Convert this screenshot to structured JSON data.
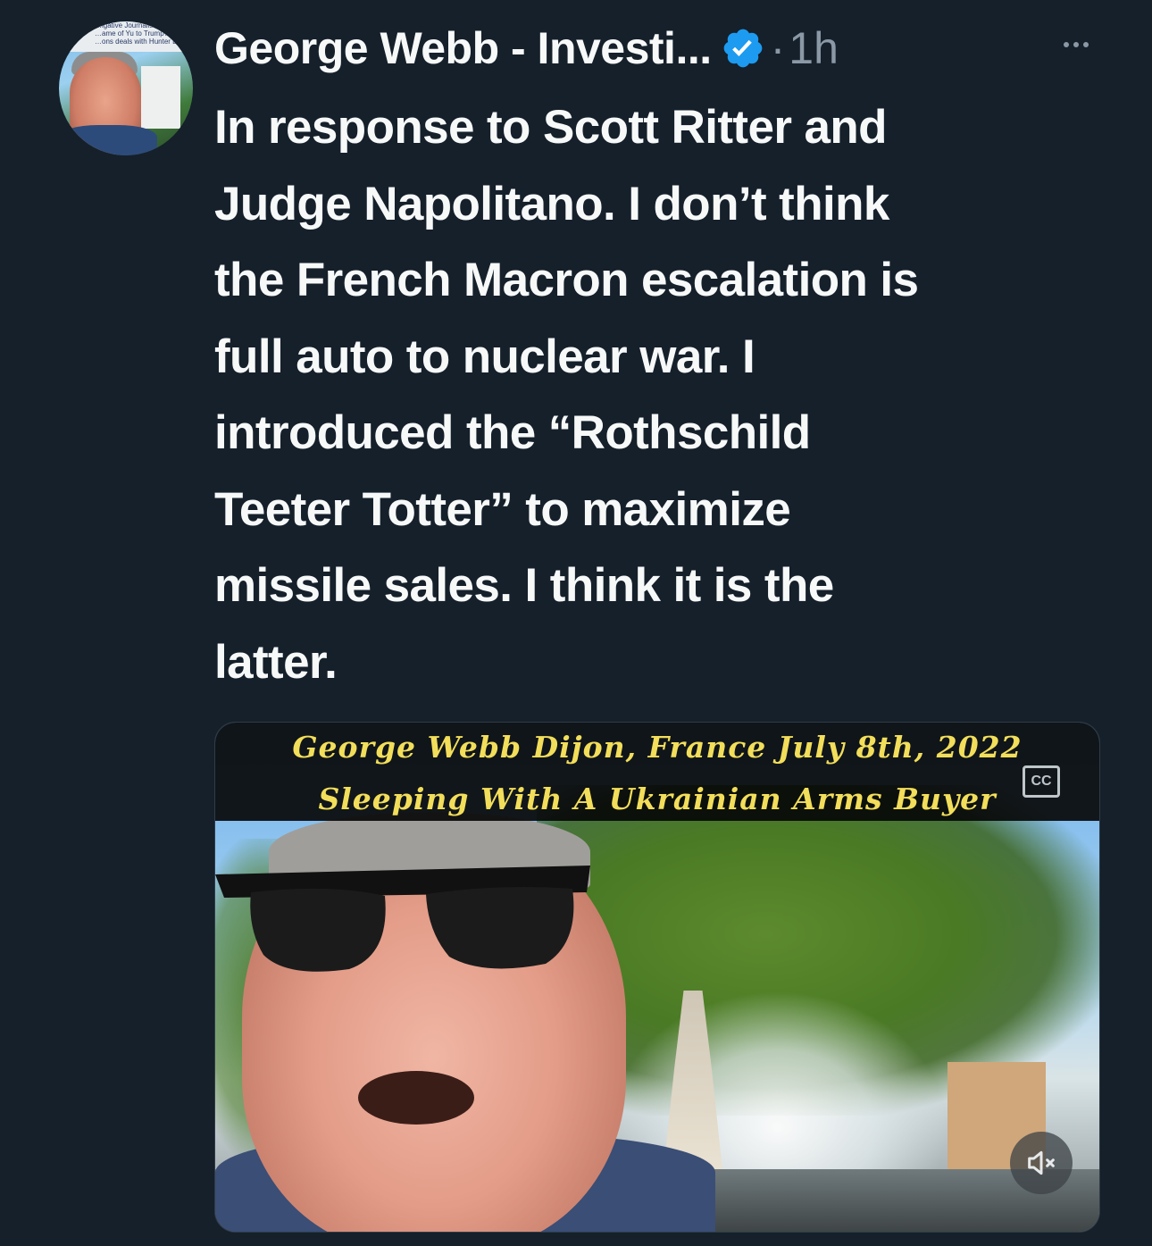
{
  "tweet": {
    "author_name": "George Webb - Investi...",
    "time": "1h",
    "separator": "·",
    "text": "In response to Scott Ritter and\nJudge Napolitano. I don’t think\nthe French Macron escalation is\nfull auto to nuclear war.  I\nintroduced the “Rothschild\nTeeter Totter” to maximize\nmissile sales.  I think it is the\nlatter.",
    "avatar_caption_lines": [
      "…igative Journalist",
      "…ame of Yu to Trump? Didn't he",
      "…ons deals with Hunter Biden with his"
    ]
  },
  "media": {
    "caption_line1": "George Webb Dijon, France July 8th, 2022",
    "caption_line2": "Sleeping With A Ukrainian Arms Buyer",
    "cc_label": "CC"
  },
  "icons": {
    "verified": "verified-badge-icon",
    "more": "more-dots-icon",
    "mute": "muted-speaker-icon",
    "cc": "closed-captions-icon"
  },
  "colors": {
    "background": "#15202b",
    "text": "#f7f9f9",
    "secondary": "#8b98a5",
    "verified": "#1d9bf0",
    "caption": "#f2de5a"
  }
}
